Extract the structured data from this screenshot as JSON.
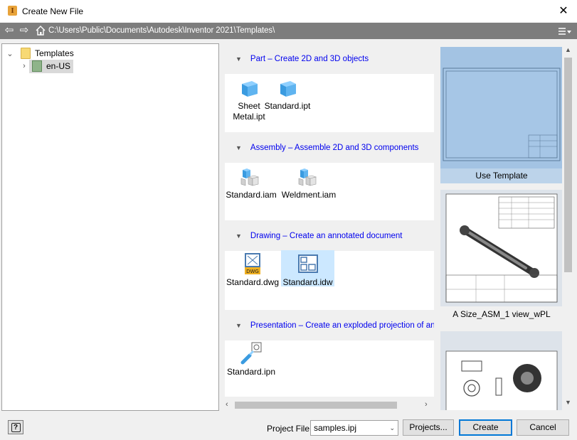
{
  "window": {
    "title": "Create New File",
    "close_label": "✕"
  },
  "pathbar": {
    "path": "C:\\Users\\Public\\Documents\\Autodesk\\Inventor 2021\\Templates\\"
  },
  "tree": {
    "items": [
      {
        "label": "Templates",
        "expanded": true
      },
      {
        "label": "en-US",
        "expanded": false,
        "selected": true
      }
    ]
  },
  "sections": [
    {
      "heading": "Part – Create 2D and 3D objects",
      "files": [
        {
          "label": "Sheet Metal.ipt",
          "line1": "Sheet",
          "line2": "Metal.ipt",
          "icon": "part-cube-icon"
        },
        {
          "label": "Standard.ipt",
          "icon": "part-cube-icon"
        }
      ]
    },
    {
      "heading": "Assembly – Assemble 2D and 3D components",
      "files": [
        {
          "label": "Standard.iam",
          "icon": "assembly-icon"
        },
        {
          "label": "Weldment.iam",
          "icon": "assembly-icon"
        }
      ]
    },
    {
      "heading": "Drawing – Create an annotated document",
      "files": [
        {
          "label": "Standard.dwg",
          "icon": "dwg-drawing-icon",
          "badge": "DWG"
        },
        {
          "label": "Standard.idw",
          "icon": "idw-drawing-icon",
          "selected": true
        }
      ]
    },
    {
      "heading": "Presentation – Create an exploded projection of an as",
      "files": [
        {
          "label": "Standard.ipn",
          "icon": "presentation-icon"
        }
      ]
    }
  ],
  "previews": [
    {
      "caption": "Use Template",
      "selected": true
    },
    {
      "caption": "A Size_ASM_1 view_wPL"
    },
    {
      "caption": ""
    }
  ],
  "bottom": {
    "project_label": "Project File:",
    "project_value": "samples.ipj",
    "projects_button": "Projects...",
    "create_button": "Create",
    "cancel_button": "Cancel",
    "help_glyph": "?"
  },
  "colors": {
    "accent": "#0078d7",
    "link": "#0000ee",
    "selection": "#cce8ff",
    "pathbar": "#7d7d7d"
  }
}
